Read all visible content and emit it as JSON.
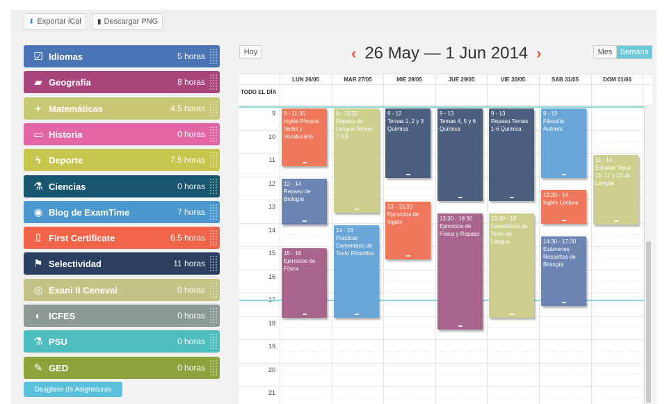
{
  "toolbar": {
    "export_ical": "Exportar iCal",
    "download_png": "Descargar PNG"
  },
  "subjects": [
    {
      "name": "Idiomas",
      "hours": "5 horas",
      "color": "#4a75b4",
      "icon": "checkbox-icon"
    },
    {
      "name": "Geografía",
      "hours": "8 horas",
      "color": "#a8457c",
      "icon": "book-icon"
    },
    {
      "name": "Matemáticas",
      "hours": "4.5 horas",
      "color": "#c8c774",
      "icon": "plus-icon"
    },
    {
      "name": "Historia",
      "hours": "0 horas",
      "color": "#e265a5",
      "icon": "open-book-icon"
    },
    {
      "name": "Deporte",
      "hours": "7.5 horas",
      "color": "#c6c64e",
      "icon": "lightning-icon"
    },
    {
      "name": "Ciencias",
      "hours": "0 horas",
      "color": "#18556e",
      "icon": "flask-icon"
    },
    {
      "name": "Blog de ExamTime",
      "hours": "7 horas",
      "color": "#4b98cf",
      "icon": "palette-icon"
    },
    {
      "name": "First Certificate",
      "hours": "6.5 horas",
      "color": "#f0644a",
      "icon": "bookmark-icon"
    },
    {
      "name": "Selectividad",
      "hours": "11 horas",
      "color": "#2b3f63",
      "icon": "flag-icon"
    },
    {
      "name": "Exani II Ceneval",
      "hours": "0 horas",
      "color": "#c2c385",
      "icon": "compass-icon"
    },
    {
      "name": "ICFES",
      "hours": "0 horas",
      "color": "#8b9a97",
      "icon": "contrast-icon"
    },
    {
      "name": "PSU",
      "hours": "0 horas",
      "color": "#4dbdbe",
      "icon": "flask-icon"
    },
    {
      "name": "GED",
      "hours": "0 horas",
      "color": "#8da43c",
      "icon": "pencil-icon"
    }
  ],
  "desglose": "Desglose de Asignaturas",
  "calendar": {
    "today_button": "Hoy",
    "title": "26 May — 1 Jun 2014",
    "prev": "‹",
    "next": "›",
    "views": [
      {
        "label": "Mes",
        "active": false
      },
      {
        "label": "Semana",
        "active": true
      }
    ],
    "all_day_label": "TODO EL DÍA",
    "days": [
      "LUN 26/05",
      "MAR 27/05",
      "MIE 28/05",
      "JUE 29/05",
      "VIE 30/05",
      "SAB 31/05",
      "DOM 01/06"
    ],
    "hours": [
      "9",
      "10",
      "11",
      "12",
      "13",
      "14",
      "15",
      "16",
      "17",
      "18",
      "19",
      "20",
      "21"
    ],
    "events": [
      {
        "day": 0,
        "start": 9.0,
        "end": 11.5,
        "time": "9 - 11:30",
        "title": "Inglés Phrasal Verbs y Vocabulario",
        "color": "#f0775b"
      },
      {
        "day": 0,
        "start": 12.0,
        "end": 14.0,
        "time": "12 - 14",
        "title": "Repaso de Biología",
        "color": "#6c85b3"
      },
      {
        "day": 0,
        "start": 15.0,
        "end": 18.0,
        "time": "15 - 18",
        "title": "Ejercicios de Física",
        "color": "#a8648c"
      },
      {
        "day": 1,
        "start": 9.0,
        "end": 13.5,
        "time": "9 - 13:30",
        "title": "Repaso de Lengua Temas 7,8,9",
        "color": "#ccd08c"
      },
      {
        "day": 1,
        "start": 14.0,
        "end": 18.0,
        "time": "14 - 18",
        "title": "Practicar Comentario de Texto Filosófico",
        "color": "#69a5d6"
      },
      {
        "day": 2,
        "start": 9.0,
        "end": 12.0,
        "time": "9 - 12",
        "title": "Temas 1, 2 y 3 Química",
        "color": "#4d5f7e"
      },
      {
        "day": 2,
        "start": 13.0,
        "end": 15.5,
        "time": "13 - 15:30",
        "title": "Ejercicios de Inglés",
        "color": "#f0775b"
      },
      {
        "day": 3,
        "start": 9.0,
        "end": 13.0,
        "time": "9 - 13",
        "title": "Temas 4, 5 y 6 Química",
        "color": "#4d5f7e"
      },
      {
        "day": 3,
        "start": 13.5,
        "end": 18.5,
        "time": "13:30 - 18:30",
        "title": "Ejercicios de Física y Repaso",
        "color": "#a8648c"
      },
      {
        "day": 4,
        "start": 9.0,
        "end": 13.0,
        "time": "9 - 13",
        "title": "Repaso Temas 1-6 Química",
        "color": "#4d5f7e"
      },
      {
        "day": 4,
        "start": 13.5,
        "end": 18.0,
        "time": "13:30 - 18",
        "title": "Comentario de Texto de Lengua",
        "color": "#ccd08c"
      },
      {
        "day": 5,
        "start": 9.0,
        "end": 12.0,
        "time": "9 - 12",
        "title": "Filosofía Autores",
        "color": "#69a5d6"
      },
      {
        "day": 5,
        "start": 12.5,
        "end": 14.0,
        "time": "12:30 - 14",
        "title": "Inglés Lectura",
        "color": "#f0775b"
      },
      {
        "day": 5,
        "start": 14.5,
        "end": 17.5,
        "time": "14:30 - 17:30",
        "title": "Exámenes Resueltos de Biología",
        "color": "#6c85b3"
      },
      {
        "day": 6,
        "start": 11.0,
        "end": 14.0,
        "time": "11 - 14",
        "title": "Estudiar Tema 10, 11 y 12 de Lengua",
        "color": "#ccd08c"
      }
    ]
  }
}
